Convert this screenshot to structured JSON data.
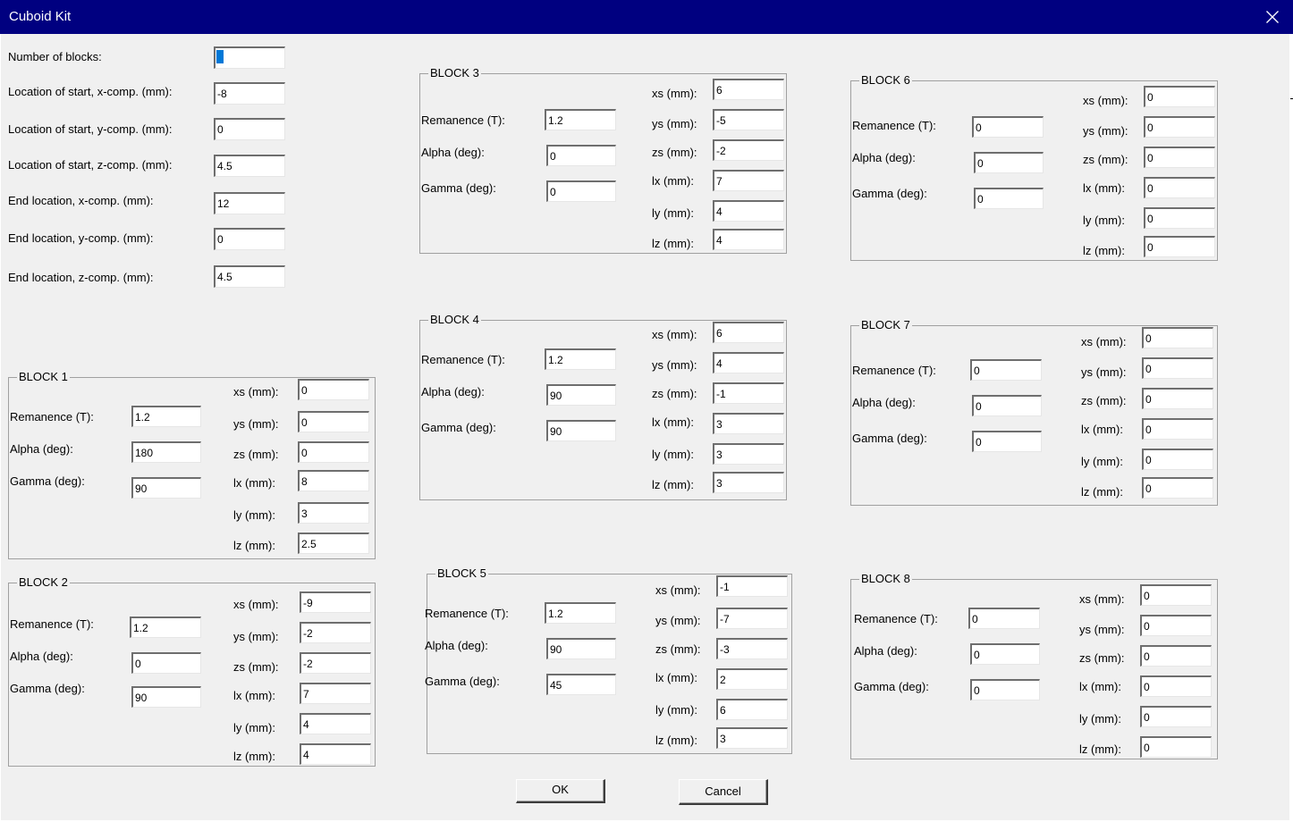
{
  "window": {
    "title": "Cuboid Kit",
    "close_icon": "close-icon"
  },
  "general": [
    {
      "label": "Number of blocks:",
      "value": "5"
    },
    {
      "label": "Location of start, x-comp. (mm):",
      "value": "-8"
    },
    {
      "label": "Location of start, y-comp. (mm):",
      "value": "0"
    },
    {
      "label": "Location of start, z-comp. (mm):",
      "value": "4.5"
    },
    {
      "label": "End location, x-comp. (mm):",
      "value": "12"
    },
    {
      "label": "End location, y-comp. (mm):",
      "value": "0"
    },
    {
      "label": "End location, z-comp. (mm):",
      "value": "4.5"
    }
  ],
  "blocks": [
    {
      "title": "BLOCK 1",
      "left": [
        {
          "label": "Remanence (T):",
          "value": "1.2"
        },
        {
          "label": "Alpha (deg):",
          "value": "180"
        },
        {
          "label": "Gamma (deg):",
          "value": "90"
        }
      ],
      "right": [
        {
          "label": "xs (mm):",
          "value": "0"
        },
        {
          "label": "ys (mm):",
          "value": "0"
        },
        {
          "label": "zs (mm):",
          "value": "0"
        },
        {
          "label": "lx (mm):",
          "value": "8"
        },
        {
          "label": "ly (mm):",
          "value": "3"
        },
        {
          "label": "lz (mm):",
          "value": "2.5"
        }
      ]
    },
    {
      "title": "BLOCK 2",
      "left": [
        {
          "label": "Remanence (T):",
          "value": "1.2"
        },
        {
          "label": "Alpha (deg):",
          "value": "0"
        },
        {
          "label": "Gamma (deg):",
          "value": "90"
        }
      ],
      "right": [
        {
          "label": "xs (mm):",
          "value": "-9"
        },
        {
          "label": "ys (mm):",
          "value": "-2"
        },
        {
          "label": "zs (mm):",
          "value": "-2"
        },
        {
          "label": "lx (mm):",
          "value": "7"
        },
        {
          "label": "ly (mm):",
          "value": "4"
        },
        {
          "label": "lz (mm):",
          "value": "4"
        }
      ]
    },
    {
      "title": "BLOCK 3",
      "left": [
        {
          "label": "Remanence (T):",
          "value": "1.2"
        },
        {
          "label": "Alpha (deg):",
          "value": "0"
        },
        {
          "label": "Gamma (deg):",
          "value": "0"
        }
      ],
      "right": [
        {
          "label": "xs (mm):",
          "value": "6"
        },
        {
          "label": "ys (mm):",
          "value": "-5"
        },
        {
          "label": "zs (mm):",
          "value": "-2"
        },
        {
          "label": "lx (mm):",
          "value": "7"
        },
        {
          "label": "ly (mm):",
          "value": "4"
        },
        {
          "label": "lz (mm):",
          "value": "4"
        }
      ]
    },
    {
      "title": "BLOCK 4",
      "left": [
        {
          "label": "Remanence (T):",
          "value": "1.2"
        },
        {
          "label": "Alpha (deg):",
          "value": "90"
        },
        {
          "label": "Gamma (deg):",
          "value": "90"
        }
      ],
      "right": [
        {
          "label": "xs (mm):",
          "value": "6"
        },
        {
          "label": "ys (mm):",
          "value": "4"
        },
        {
          "label": "zs (mm):",
          "value": "-1"
        },
        {
          "label": "lx (mm):",
          "value": "3"
        },
        {
          "label": "ly (mm):",
          "value": "3"
        },
        {
          "label": "lz (mm):",
          "value": "3"
        }
      ]
    },
    {
      "title": "BLOCK 5",
      "left": [
        {
          "label": "Remanence (T):",
          "value": "1.2"
        },
        {
          "label": "Alpha (deg):",
          "value": "90"
        },
        {
          "label": "Gamma (deg):",
          "value": "45"
        }
      ],
      "right": [
        {
          "label": "xs (mm):",
          "value": "-1"
        },
        {
          "label": "ys (mm):",
          "value": "-7"
        },
        {
          "label": "zs (mm):",
          "value": "-3"
        },
        {
          "label": "lx (mm):",
          "value": "2"
        },
        {
          "label": "ly (mm):",
          "value": "6"
        },
        {
          "label": "lz (mm):",
          "value": "3"
        }
      ]
    },
    {
      "title": "BLOCK 6",
      "left": [
        {
          "label": "Remanence (T):",
          "value": "0"
        },
        {
          "label": "Alpha (deg):",
          "value": "0"
        },
        {
          "label": "Gamma (deg):",
          "value": "0"
        }
      ],
      "right": [
        {
          "label": "xs (mm):",
          "value": "0"
        },
        {
          "label": "ys (mm):",
          "value": "0"
        },
        {
          "label": "zs (mm):",
          "value": "0"
        },
        {
          "label": "lx (mm):",
          "value": "0"
        },
        {
          "label": "ly (mm):",
          "value": "0"
        },
        {
          "label": "lz (mm):",
          "value": "0"
        }
      ]
    },
    {
      "title": "BLOCK 7",
      "left": [
        {
          "label": "Remanence (T):",
          "value": "0"
        },
        {
          "label": "Alpha (deg):",
          "value": "0"
        },
        {
          "label": "Gamma (deg):",
          "value": "0"
        }
      ],
      "right": [
        {
          "label": "xs (mm):",
          "value": "0"
        },
        {
          "label": "ys (mm):",
          "value": "0"
        },
        {
          "label": "zs (mm):",
          "value": "0"
        },
        {
          "label": "lx (mm):",
          "value": "0"
        },
        {
          "label": "ly (mm):",
          "value": "0"
        },
        {
          "label": "lz (mm):",
          "value": "0"
        }
      ]
    },
    {
      "title": "BLOCK 8",
      "left": [
        {
          "label": "Remanence (T):",
          "value": "0"
        },
        {
          "label": "Alpha (deg):",
          "value": "0"
        },
        {
          "label": "Gamma (deg):",
          "value": "0"
        }
      ],
      "right": [
        {
          "label": "xs (mm):",
          "value": "0"
        },
        {
          "label": "ys (mm):",
          "value": "0"
        },
        {
          "label": "zs (mm):",
          "value": "0"
        },
        {
          "label": "lx (mm):",
          "value": "0"
        },
        {
          "label": "ly (mm):",
          "value": "0"
        },
        {
          "label": "lz (mm):",
          "value": "0"
        }
      ]
    }
  ],
  "buttons": {
    "ok": "OK",
    "cancel": "Cancel"
  },
  "colors": {
    "titlebar": "#000080",
    "dialog": "#f0f0f0",
    "selection": "#0078d7"
  }
}
